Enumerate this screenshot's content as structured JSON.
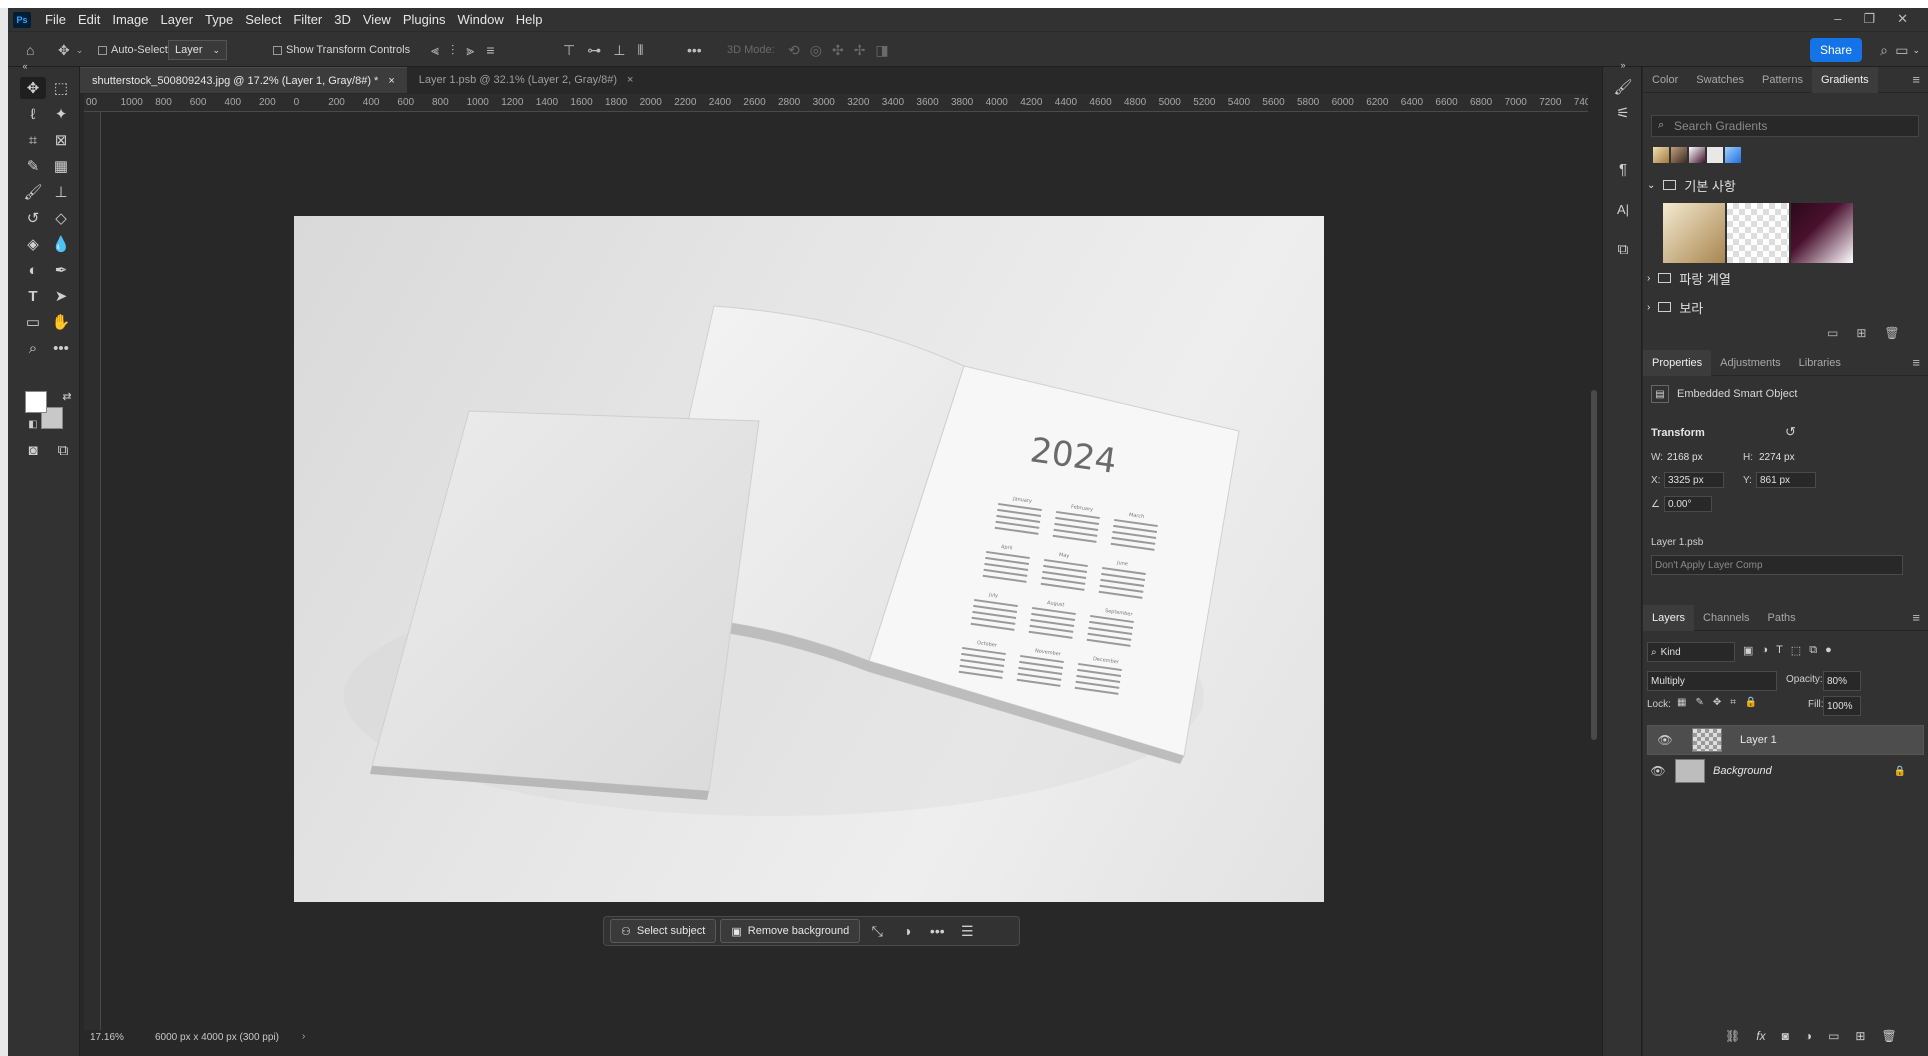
{
  "app": {
    "name": "Photoshop",
    "logo": "Ps"
  },
  "menu": [
    "File",
    "Edit",
    "Image",
    "Layer",
    "Type",
    "Select",
    "Filter",
    "3D",
    "View",
    "Plugins",
    "Window",
    "Help"
  ],
  "options": {
    "auto_select_label": "Auto-Select:",
    "auto_select_value": "Layer",
    "transform_label": "Show Transform Controls",
    "mode_3d_label": "3D Mode:",
    "share_label": "Share"
  },
  "tabs": [
    {
      "label": "shutterstock_500809243.jpg @ 17.2% (Layer 1, Gray/8#) *",
      "active": true
    },
    {
      "label": "Layer 1.psb @ 32.1% (Layer 2, Gray/8#)",
      "active": false
    }
  ],
  "ruler": {
    "h_labels": [
      "00",
      "1000",
      "800",
      "600",
      "400",
      "200",
      "0",
      "200",
      "400",
      "600",
      "800",
      "1000",
      "1200",
      "1400",
      "1600",
      "1800",
      "2000",
      "2200",
      "2400",
      "2600",
      "2800",
      "3000",
      "3200",
      "3400",
      "3600",
      "3800",
      "4000",
      "4200",
      "4400",
      "4600",
      "4800",
      "5000",
      "5200",
      "5400",
      "5600",
      "5800",
      "6000",
      "6200",
      "6400",
      "6600",
      "6800",
      "7000",
      "7200",
      "740"
    ]
  },
  "canvas": {
    "calendar_year": "2024",
    "months": [
      "January",
      "February",
      "March",
      "April",
      "May",
      "June",
      "July",
      "August",
      "September",
      "October",
      "November",
      "December"
    ]
  },
  "taskbar": {
    "select_subject": "Select subject",
    "remove_background": "Remove background"
  },
  "status": {
    "zoom": "17.16%",
    "doc_info": "6000 px x 4000 px (300 ppi)"
  },
  "gradients_panel": {
    "tabs": [
      "Color",
      "Swatches",
      "Patterns",
      "Gradients"
    ],
    "search_placeholder": "Search Gradients",
    "folders": [
      "기본 사항",
      "파랑 계열",
      "보라"
    ]
  },
  "properties_panel": {
    "tabs": [
      "Properties",
      "Adjustments",
      "Libraries"
    ],
    "object_type": "Embedded Smart Object",
    "section": "Transform",
    "w_label": "W:",
    "w_value": "2168 px",
    "h_label": "H:",
    "h_value": "2274 px",
    "x_label": "X:",
    "x_value": "3325 px",
    "y_label": "Y:",
    "y_value": "861 px",
    "angle_value": "0.00°",
    "file_name": "Layer 1.psb",
    "layer_comp": "Don't Apply Layer Comp"
  },
  "layers_panel": {
    "tabs": [
      "Layers",
      "Channels",
      "Paths"
    ],
    "filter_kind": "Kind",
    "blend_mode": "Multiply",
    "opacity_label": "Opacity:",
    "opacity_value": "80%",
    "lock_label": "Lock:",
    "fill_label": "Fill:",
    "fill_value": "100%",
    "layers": [
      {
        "name": "Layer 1",
        "selected": true
      },
      {
        "name": "Background",
        "selected": false,
        "locked": true
      }
    ]
  },
  "colors": {
    "accent": "#1473e6",
    "panel_bg": "#323232",
    "app_bg": "#282828",
    "foreground": "#ffffff",
    "background_swatch": "#c8c8c8"
  }
}
